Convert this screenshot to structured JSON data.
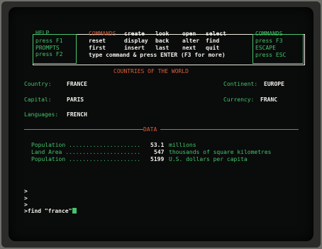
{
  "function_keys": {
    "help_label": "HELP",
    "help_key": "press F1",
    "prompts_label": "PROMPTS",
    "prompts_key": "press F2",
    "commands_label": "COMMANDS",
    "commands_key": "press F3",
    "escape_label": "ESCAPE",
    "escape_key": "press ESC"
  },
  "commands": {
    "title": "COMMANDS",
    "row1": [
      "create",
      "look",
      "open",
      "select"
    ],
    "row2": [
      "reset",
      "display",
      "back",
      "alter",
      "find"
    ],
    "row3": [
      "first",
      "insert",
      "last",
      "next",
      "quit"
    ],
    "hint": "type command & press ENTER (F3 for more)"
  },
  "screen_title": "COUNTRIES OF THE WORLD",
  "fields": {
    "country_label": "Country:",
    "country_value": "FRANCE",
    "capital_label": "Capital:",
    "capital_value": "PARIS",
    "languages_label": "Languages:",
    "languages_value": "FRENCH",
    "continent_label": "Continent:",
    "continent_value": "EUROPE",
    "currency_label": "Currency:",
    "currency_value": "FRANC"
  },
  "data_section": {
    "title": "DATA",
    "rows": [
      {
        "label": "Population .....................",
        "value": "53.1",
        "unit": "millions"
      },
      {
        "label": "Land Area ......................",
        "value": "547",
        "unit": "thousands of square kilometres"
      },
      {
        "label": "Population .....................",
        "value": "5199",
        "unit": "U.S. dollars per capita"
      }
    ]
  },
  "prompt": {
    "lines": [
      ">",
      ">",
      ">"
    ],
    "command": ">find \"france\""
  },
  "colors": {
    "green": "#44c46b",
    "orange": "#d9603a",
    "white": "#f0f0ea",
    "screen": "#0a0b0b"
  }
}
